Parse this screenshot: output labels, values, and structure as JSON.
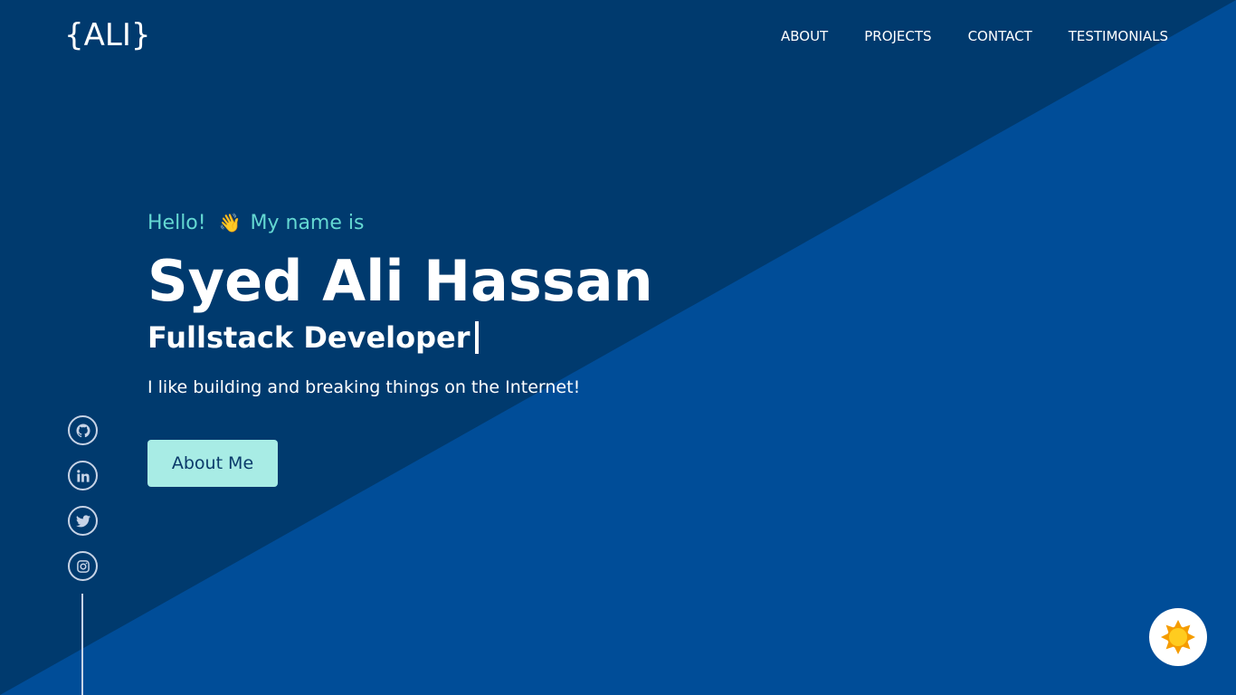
{
  "colors": {
    "background_dark": "#003a6e",
    "background_light": "#004d98",
    "accent_teal": "#64d8d2",
    "button_bg": "#a8ece5",
    "button_text": "#0a3a6a",
    "social_stroke": "#c7d3e6",
    "sun": "#ffcc1f",
    "sun_rays": "#f59c00"
  },
  "header": {
    "logo": "{ALI}",
    "nav": [
      {
        "label": "ABOUT"
      },
      {
        "label": "PROJECTS"
      },
      {
        "label": "CONTACT"
      },
      {
        "label": "TESTIMONIALS"
      }
    ]
  },
  "hero": {
    "greeting_prefix": "Hello!",
    "greeting_emoji": "👋",
    "greeting_suffix": "My name is",
    "name": "Syed Ali Hassan",
    "role": "Fullstack Developer",
    "tagline": "I like building and breaking things on the Internet!",
    "cta_label": "About Me"
  },
  "social": [
    {
      "icon": "github-icon"
    },
    {
      "icon": "linkedin-icon"
    },
    {
      "icon": "twitter-icon"
    },
    {
      "icon": "instagram-icon"
    }
  ],
  "theme_toggle": {
    "icon": "sun-icon"
  }
}
